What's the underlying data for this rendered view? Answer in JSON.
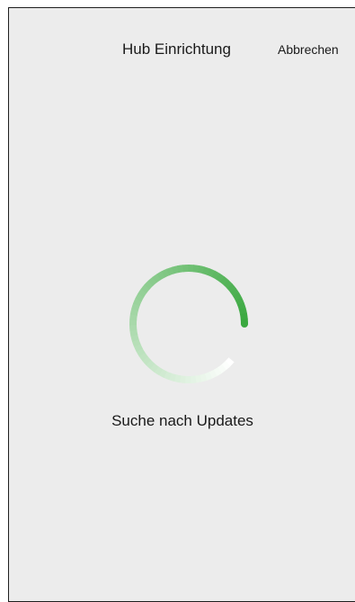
{
  "header": {
    "title": "Hub Einrichtung",
    "cancel_label": "Abbrechen"
  },
  "main": {
    "status": "Suche nach Updates"
  },
  "spinner": {
    "icon": "loading-spinner-icon",
    "color_start": "#ffffff",
    "color_end": "#3aa83f"
  }
}
